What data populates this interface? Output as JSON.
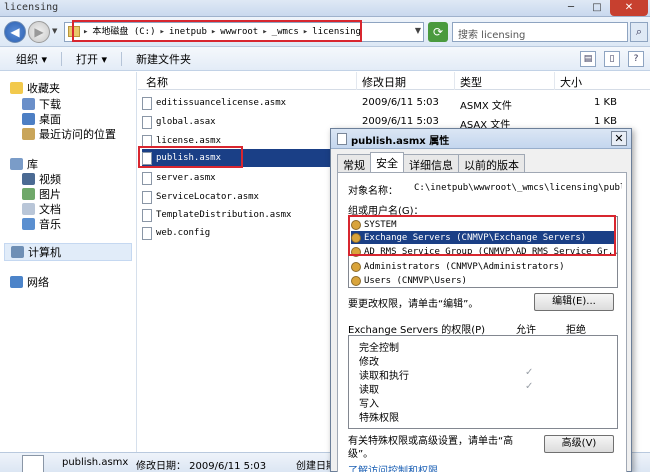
{
  "window": {
    "title": "licensing",
    "buttons": [
      "─",
      "□",
      "✕"
    ]
  },
  "address": {
    "crumbs": [
      "本地磁盘 (C:)",
      "inetpub",
      "wwwroot",
      "_wmcs",
      "licensing"
    ],
    "search_placeholder": "搜索 licensing"
  },
  "toolbar": {
    "organize": "组织 ▾",
    "open": "打开 ▾",
    "new_folder": "新建文件夹"
  },
  "nav": {
    "favorites": "收藏夹",
    "downloads": "下载",
    "desktop": "桌面",
    "recent": "最近访问的位置",
    "libraries": "库",
    "videos": "视频",
    "pictures": "图片",
    "documents": "文档",
    "music": "音乐",
    "computer": "计算机",
    "network": "网络"
  },
  "columns": {
    "name": "名称",
    "modified": "修改日期",
    "type": "类型",
    "size": "大小"
  },
  "files": [
    {
      "name": "editissuancelicense.asmx",
      "date": "2009/6/11 5:03",
      "type": "ASMX 文件",
      "size": "1 KB"
    },
    {
      "name": "global.asax",
      "date": "2009/6/11 5:03",
      "type": "ASAX 文件",
      "size": "1 KB"
    },
    {
      "name": "license.asmx",
      "date": "",
      "type": "",
      "size": ""
    },
    {
      "name": "publish.asmx",
      "date": "",
      "type": "",
      "size": ""
    },
    {
      "name": "server.asmx",
      "date": "",
      "type": "",
      "size": ""
    },
    {
      "name": "ServiceLocator.asmx",
      "date": "",
      "type": "",
      "size": ""
    },
    {
      "name": "TemplateDistribution.asmx",
      "date": "",
      "type": "",
      "size": ""
    },
    {
      "name": "web.config",
      "date": "",
      "type": "",
      "size": ""
    }
  ],
  "details": {
    "name": "publish.asmx",
    "modified": "修改日期： 2009/6/11 5:03",
    "created": "创建日期："
  },
  "dialog": {
    "title": "publish.asmx 属性",
    "close": "✕",
    "tabs": [
      "常规",
      "安全",
      "详细信息",
      "以前的版本"
    ],
    "object_label": "对象名称：",
    "object_path": "C:\\inetpub\\wwwroot\\_wmcs\\licensing\\publi",
    "group_label": "组或用户名(G)：",
    "users": [
      "SYSTEM",
      "Exchange Servers (CNMVP\\Exchange Servers)",
      "AD RMS Service Group (CNMVP\\AD RMS Service Gr...",
      "Administrators (CNMVP\\Administrators)",
      "Users (CNMVP\\Users)"
    ],
    "change_text": "要更改权限，请单击“编辑”。",
    "edit_button": "编辑(E)...",
    "perm_label": "Exchange Servers 的权限(P)",
    "allow": "允许",
    "deny": "拒绝",
    "permissions": [
      {
        "name": "完全控制",
        "allow": false
      },
      {
        "name": "修改",
        "allow": false
      },
      {
        "name": "读取和执行",
        "allow": true
      },
      {
        "name": "读取",
        "allow": true
      },
      {
        "name": "写入",
        "allow": false
      },
      {
        "name": "特殊权限",
        "allow": false
      }
    ],
    "check_mark": "✓",
    "special_text": "有关特殊权限或高级设置，请单击“高级”。",
    "advanced_button": "高级(V)",
    "learn_link": "了解访问控制和权限"
  }
}
